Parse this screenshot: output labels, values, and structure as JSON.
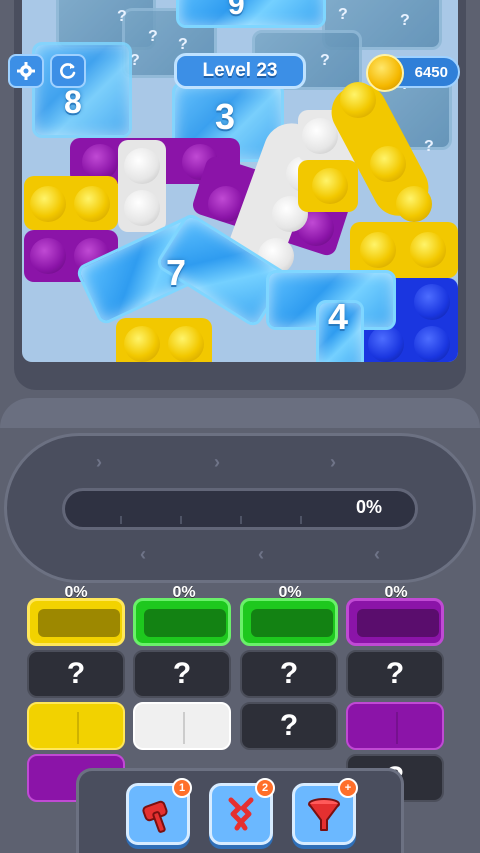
{
  "hud": {
    "settings_icon": "gear-icon",
    "restart_icon": "restart-icon",
    "level_label": "Level 23",
    "coins": "6450"
  },
  "board": {
    "ice_counts": [
      "9",
      "8",
      "3",
      "7",
      "4"
    ],
    "hidden_marks": [
      "?",
      "?",
      "?",
      "?",
      "?",
      "?",
      "?",
      "?",
      "?"
    ],
    "colors": {
      "yellow": "#f2c800",
      "purple": "#8b14a8",
      "white": "#ececec",
      "blue": "#1a36e0",
      "ice": "#3aa5f2",
      "green": "#1ec81e"
    }
  },
  "conveyor": {
    "progress_label": "0%",
    "progress": 0
  },
  "bins": {
    "column_percents": [
      "0%",
      "0%",
      "0%",
      "0%"
    ],
    "mystery_label": "?"
  },
  "boosters": [
    {
      "icon": "hammer-icon",
      "count": "1"
    },
    {
      "icon": "magnet-icon",
      "count": "2"
    },
    {
      "icon": "funnel-icon",
      "count": "+"
    }
  ]
}
